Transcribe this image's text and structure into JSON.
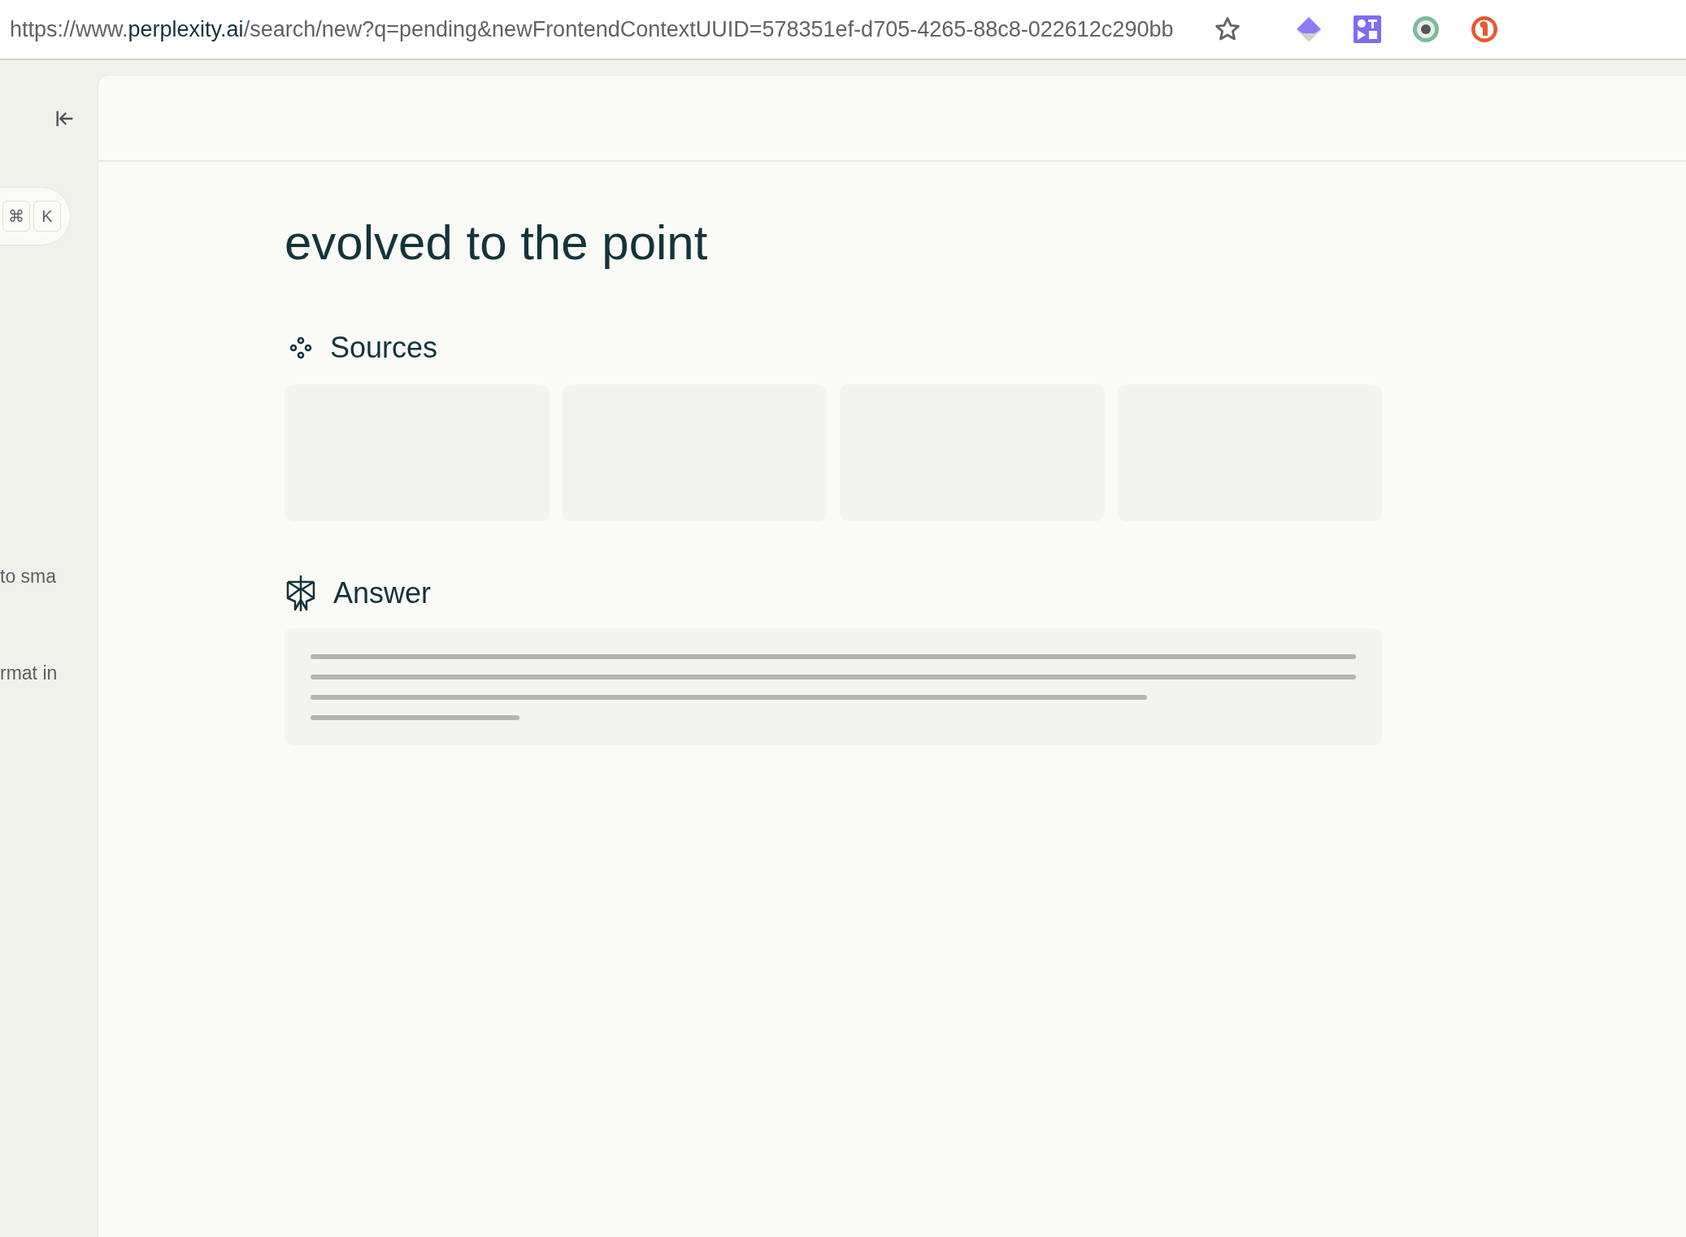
{
  "address_bar": {
    "scheme": "https://www.",
    "host": "perplexity.ai",
    "path": "/search/new?q=pending&newFrontendContextUUID=578351ef-d705-4265-88c8-022612c290bb"
  },
  "sidebar": {
    "shortcut_keys": [
      "⌘",
      "K"
    ],
    "items": [
      "to sma",
      "rmat in"
    ]
  },
  "query_title": "evolved to the point",
  "sources": {
    "heading": "Sources"
  },
  "answer": {
    "heading": "Answer"
  }
}
